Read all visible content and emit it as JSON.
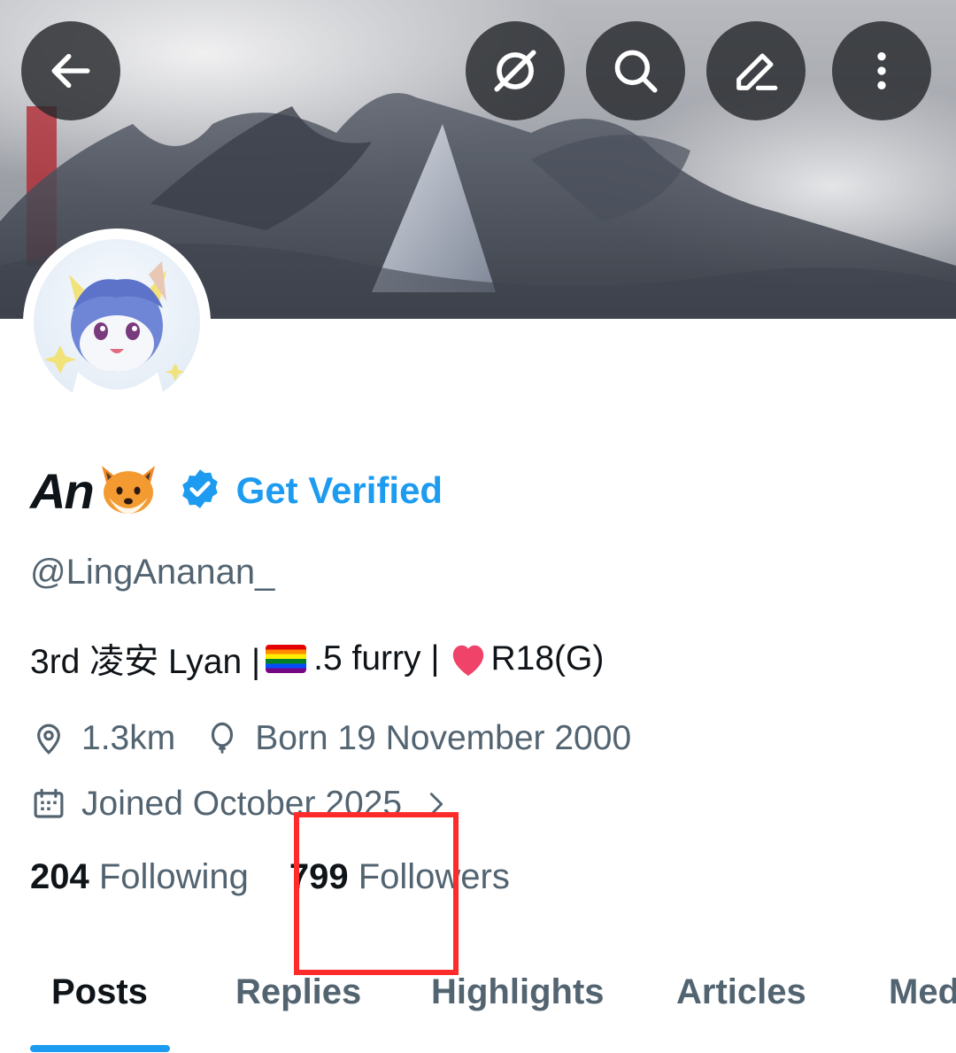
{
  "profile": {
    "display_name": "An",
    "name_emoji": "fox-face",
    "get_verified_label": "Get Verified",
    "handle": "@LingAnanan_",
    "bio_part1": "3rd 凌安 Lyan |",
    "bio_part2": ".5 furry |",
    "bio_part3": "R18(G)",
    "location": "1.3km",
    "birthday": "Born 19 November 2000",
    "joined": "Joined October 2025"
  },
  "counts": {
    "following_count": "204",
    "following_label": "Following",
    "followers_count": "799",
    "followers_label": "Followers"
  },
  "tabs": [
    "Posts",
    "Replies",
    "Highlights",
    "Articles",
    "Media"
  ],
  "active_tab": "Posts",
  "icons": [
    "back-arrow-icon",
    "grok-icon",
    "search-icon",
    "edit-icon",
    "more-vertical-icon",
    "verified-badge-icon",
    "location-pin-icon",
    "balloon-icon",
    "calendar-icon",
    "chevron-right-icon"
  ],
  "colors": {
    "accent": "#1d9bf0",
    "highlight_box": "#ff2a2a",
    "secondary_text": "#536471"
  }
}
